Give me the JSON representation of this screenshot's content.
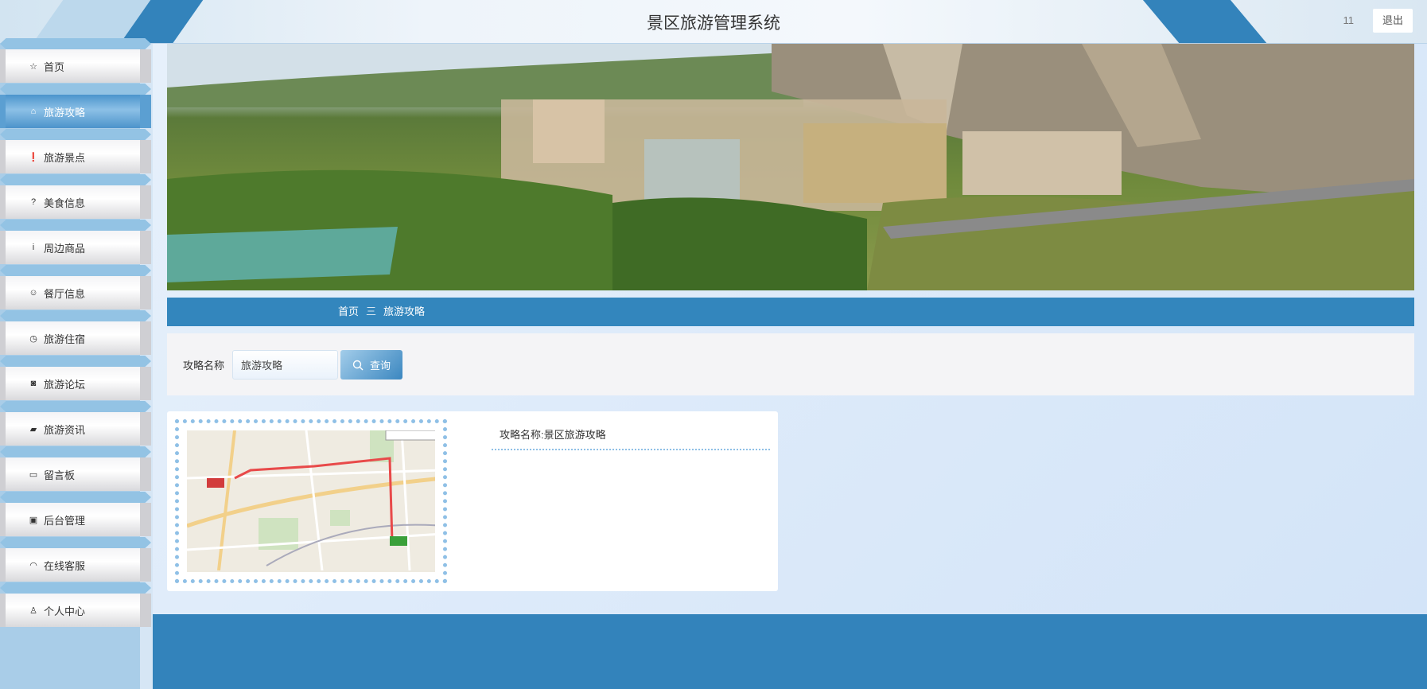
{
  "header": {
    "title": "景区旅游管理系统",
    "username": "11",
    "logout_label": "退出"
  },
  "sidebar": {
    "items": [
      {
        "label": "首页",
        "icon": "star-icon"
      },
      {
        "label": "旅游攻略",
        "icon": "bag-icon",
        "active": true
      },
      {
        "label": "旅游景点",
        "icon": "exclamation-circle-icon"
      },
      {
        "label": "美食信息",
        "icon": "question-circle-icon"
      },
      {
        "label": "周边商品",
        "icon": "info-circle-icon"
      },
      {
        "label": "餐厅信息",
        "icon": "smile-icon"
      },
      {
        "label": "旅游住宿",
        "icon": "clock-icon"
      },
      {
        "label": "旅游论坛",
        "icon": "camera-icon"
      },
      {
        "label": "旅游资讯",
        "icon": "car-icon"
      },
      {
        "label": "留言板",
        "icon": "video-icon"
      },
      {
        "label": "后台管理",
        "icon": "briefcase-icon"
      },
      {
        "label": "在线客服",
        "icon": "headset-icon"
      },
      {
        "label": "个人中心",
        "icon": "user-icon"
      }
    ]
  },
  "breadcrumb": {
    "home": "首页",
    "separator": "三",
    "current": "旅游攻略"
  },
  "search": {
    "label": "攻略名称",
    "value": "旅游攻略",
    "button": "查询"
  },
  "results": [
    {
      "name": "攻略名称:景区旅游攻略"
    }
  ],
  "colors": {
    "primary": "#3386bd",
    "sidebar": "#a9cde8"
  }
}
